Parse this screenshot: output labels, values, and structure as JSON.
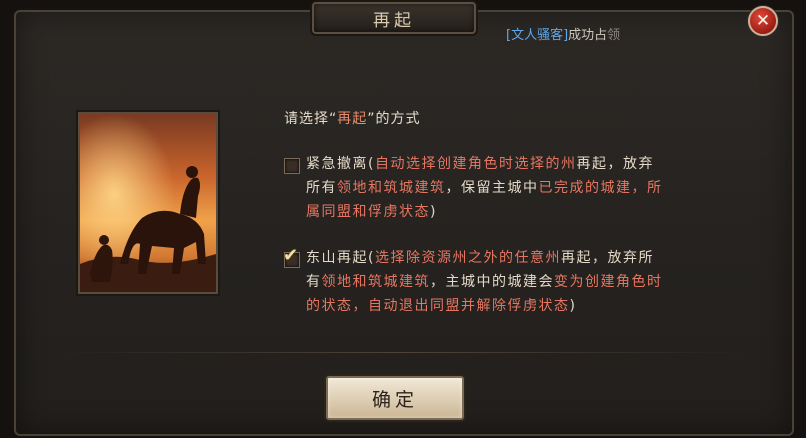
{
  "dialog": {
    "title": "再起",
    "close_icon": "close-icon",
    "notice": {
      "user": "[文人骚客]",
      "text": "成功占",
      "faded": "领"
    },
    "prompt": {
      "prefix": "请选择",
      "open_quote": "“",
      "keyword": "再起",
      "close_quote": "”",
      "suffix": "的方式"
    },
    "options": [
      {
        "checked": false,
        "label": "紧急撤离",
        "segments": [
          "(",
          "自动选择创建角色时选择的州",
          "再起，放弃所有",
          "领地和筑城建筑",
          "，保留主城中",
          "已完成的城建，所属同盟和俘虏状态",
          ")"
        ]
      },
      {
        "checked": true,
        "label": "东山再起",
        "segments": [
          "(",
          "选择除资源州之外的任意州",
          "再起，放弃所有",
          "领地和筑城建筑",
          "，主城中的城建会",
          "变为创建角色时的状态，自动退出同盟并解除俘虏状态",
          ")"
        ]
      }
    ],
    "confirm_label": "确定"
  },
  "colors": {
    "highlight": "#e67661",
    "user_blue": "#5ea6e8",
    "body_text": "#e4d9c7",
    "close_red": "#c8281c"
  }
}
